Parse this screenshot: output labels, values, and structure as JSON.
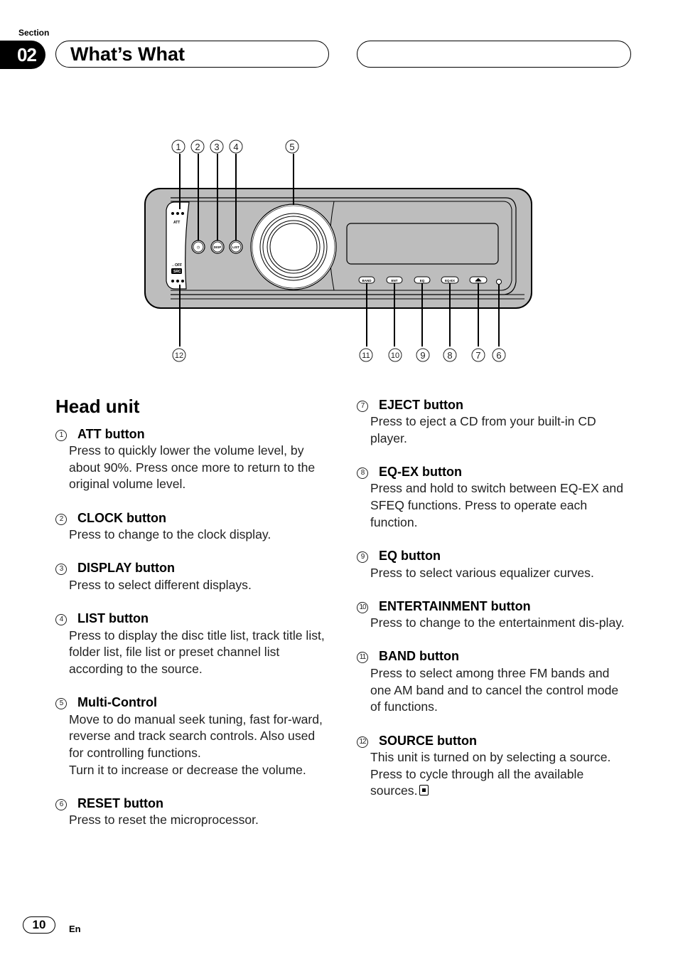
{
  "header": {
    "section_label": "Section",
    "section_number": "02",
    "title": "What’s What"
  },
  "diagram": {
    "panel_color": "#bdbdbd",
    "panel_labels": {
      "att": "ATT",
      "clock": "◷",
      "disp": "DISP",
      "list": "LIST",
      "off": "↔OFF",
      "src": "SRC",
      "band": "BAND",
      "ent": "ENT",
      "eq": "EQ",
      "eqex": "EQ-EX",
      "eject": "⏏"
    },
    "callouts": [
      "1",
      "2",
      "3",
      "4",
      "5",
      "6",
      "7",
      "8",
      "9",
      "10",
      "11",
      "12"
    ]
  },
  "heading": "Head unit",
  "items_left": [
    {
      "num": "1",
      "title": "ATT button",
      "body": "Press to quickly lower the volume level, by about 90%. Press once more to return to the original volume level."
    },
    {
      "num": "2",
      "title": "CLOCK button",
      "body": "Press to change to the clock display."
    },
    {
      "num": "3",
      "title": "DISPLAY button",
      "body": "Press to select different displays."
    },
    {
      "num": "4",
      "title": "LIST button",
      "body": "Press to display the disc title list, track title list, folder list, file list or preset channel list according to the source."
    },
    {
      "num": "5",
      "title": "Multi-Control",
      "body": "Move to do manual seek tuning, fast for-ward, reverse and track search controls. Also used for controlling functions.",
      "body2": "Turn it to increase or decrease the volume."
    },
    {
      "num": "6",
      "title": "RESET button",
      "body": "Press to reset the microprocessor."
    }
  ],
  "items_right": [
    {
      "num": "7",
      "title": "EJECT button",
      "body": "Press to eject a CD from your built-in CD player."
    },
    {
      "num": "8",
      "title": "EQ-EX button",
      "body": "Press and hold to switch between EQ-EX and SFEQ functions. Press to operate each function."
    },
    {
      "num": "9",
      "title": "EQ button",
      "body": "Press to select various equalizer curves."
    },
    {
      "num": "10",
      "title": "ENTERTAINMENT button",
      "body": "Press to change to the entertainment dis-play."
    },
    {
      "num": "11",
      "title": "BAND button",
      "body": "Press to select among three FM bands and one AM band and to cancel the control mode of functions."
    },
    {
      "num": "12",
      "title": "SOURCE button",
      "body": "This unit is turned on by selecting a source. Press to cycle through all the available sources."
    }
  ],
  "footer": {
    "page_number": "10",
    "language": "En"
  }
}
